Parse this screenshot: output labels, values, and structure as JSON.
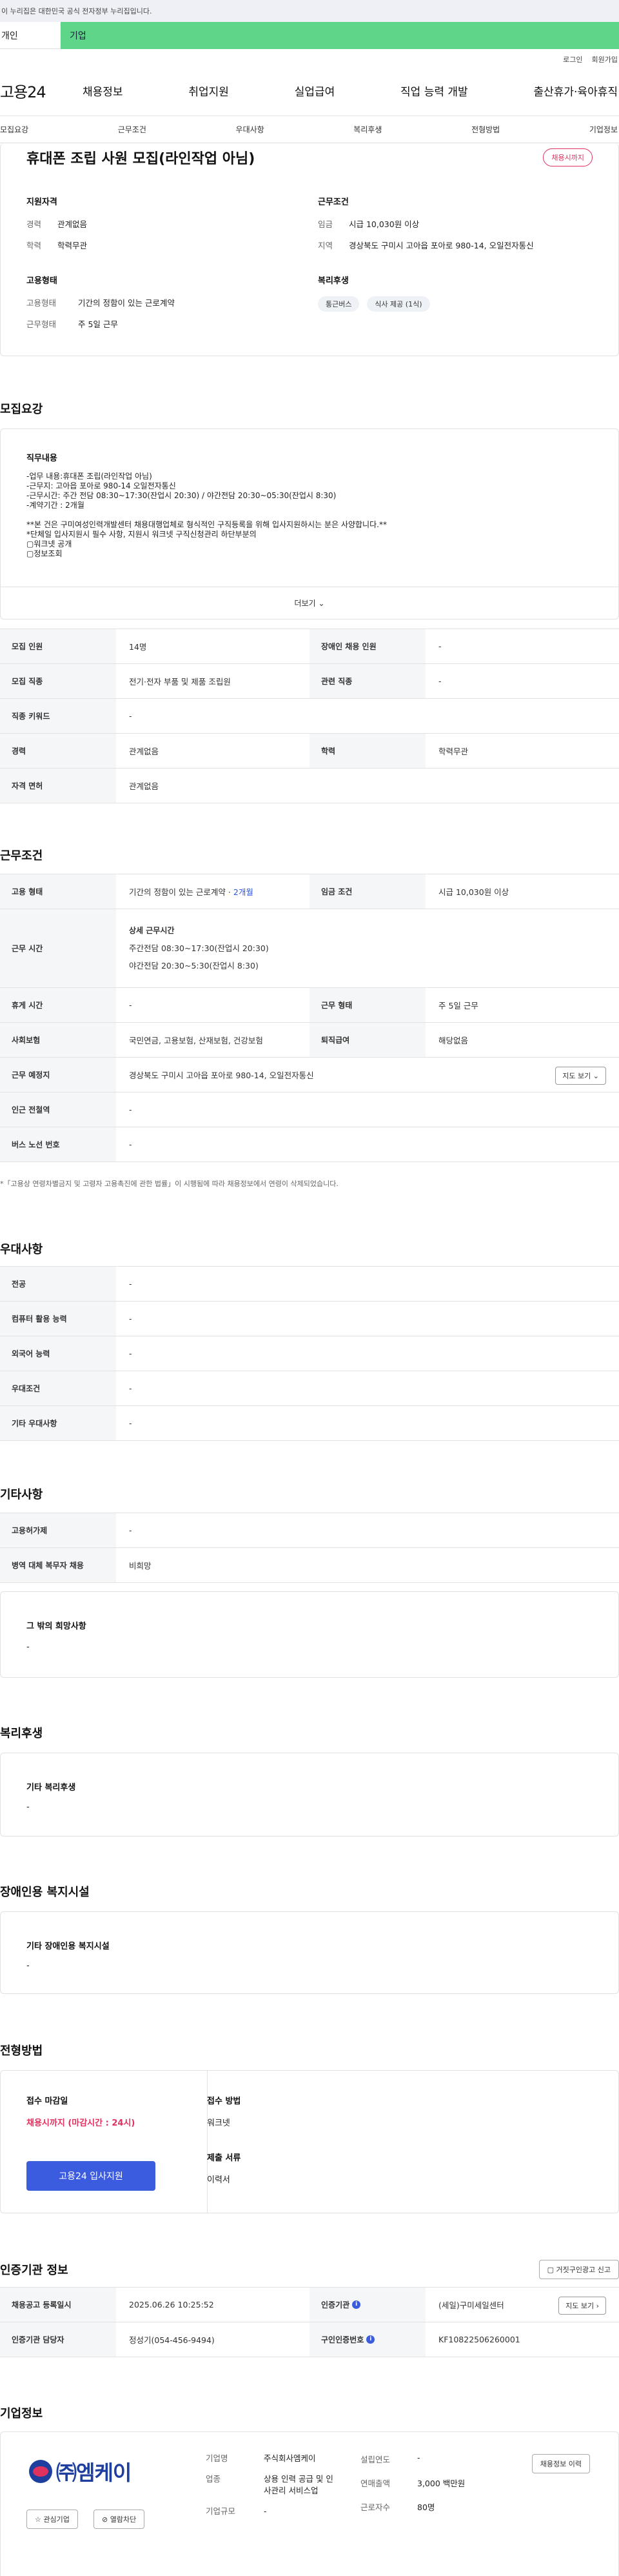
{
  "gov_notice": "이 누리집은 대한민국 공식 전자정부 누리집입니다.",
  "user_tabs": {
    "personal": "개인",
    "corporate": "기업"
  },
  "util": {
    "login": "로그인",
    "join": "회원가입"
  },
  "logo": "고용24",
  "gnb": [
    "채용정보",
    "취업지원",
    "실업급여",
    "직업 능력 개발",
    "출산휴가·육아휴직"
  ],
  "anchor_tabs": [
    "모집요강",
    "근무조건",
    "우대사항",
    "복리후생",
    "전형방법",
    "기업정보"
  ],
  "job": {
    "title": "휴대폰 조립 사원 모집(라인작업 아님)",
    "badge": "채용시까지",
    "qual_title": "지원자격",
    "qual": [
      {
        "k": "경력",
        "v": "관계없음"
      },
      {
        "k": "학력",
        "v": "학력무관"
      }
    ],
    "cond_title": "근무조건",
    "cond": [
      {
        "k": "임금",
        "v": "시급 10,030원 이상"
      },
      {
        "k": "지역",
        "v": "경상북도 구미시 고아읍 포아로 980-14, 오일전자통신"
      }
    ],
    "form_title": "고용형태",
    "form": [
      {
        "k": "고용형태",
        "v": "기간의 정함이 있는 근로계약"
      },
      {
        "k": "근무형태",
        "v": "주 5일 근무"
      }
    ],
    "welfare_title": "복리후생",
    "welfare_chips": [
      "통근버스",
      "식사 제공 (1식)"
    ]
  },
  "recruit": {
    "section_title": "모집요강",
    "duty_title": "직무내용",
    "duty_lines": [
      "-업무 내용:휴대폰 조립(라인작업 아님)",
      "-근무지: 고아읍 포아로 980-14 오일전자통신",
      "-근무시간: 주간 전담 08:30~17:30(잔업시 20:30) / 야간전담 20:30~05:30(잔업시 8:30)",
      "-계약기간 : 2개월",
      "",
      "**본 건은 구미여성인력개발센터 채용대행업체로 형식적인 구직등록을 위해 입사지원하시는 분은 사양합니다.**",
      "*단체일 입사지원시 필수 사항, 지원시 워크넷 구직신청관리 하단부분의",
      "▢워크넷 공개",
      "▢정보조회"
    ],
    "more": "더보기",
    "rows": [
      [
        {
          "k": "모집 인원",
          "v": "14명"
        },
        {
          "k": "장애인 채용 인원",
          "v": "-"
        }
      ],
      [
        {
          "k": "모집 직종",
          "v": "전기·전자 부품 및 제품 조립원"
        },
        {
          "k": "관련 직종",
          "v": "-"
        }
      ],
      [
        {
          "k": "직종 키워드",
          "v": "-"
        }
      ],
      [
        {
          "k": "경력",
          "v": "관계없음"
        },
        {
          "k": "학력",
          "v": "학력무관"
        }
      ],
      [
        {
          "k": "자격 면허",
          "v": "관계없음"
        }
      ]
    ]
  },
  "work": {
    "section_title": "근무조건",
    "emp_k": "고용 형태",
    "emp_v": "기간의 정함이 있는 근로계약 · ",
    "emp_months": "2개월",
    "wage_k": "임금 조건",
    "wage_v": "시급 10,030원 이상",
    "time_k": "근무 시간",
    "time_title": "상세 근무시간",
    "time_lines": [
      "주간전담 08:30~17:30(잔업시 20:30)",
      "야간전담 20:30~5:30(잔업시 8:30)"
    ],
    "rest_k": "휴게 시간",
    "rest_v": "-",
    "shape_k": "근무 형태",
    "shape_v": "주 5일 근무",
    "ins_k": "사회보험",
    "ins_v": "국민연금, 고용보험, 산재보험, 건강보험",
    "sev_k": "퇴직급여",
    "sev_v": "해당없음",
    "loc_k": "근무 예정지",
    "loc_v": "경상북도 구미시 고아읍 포아로 980-14, 오일전자통신",
    "map_btn": "지도 보기",
    "sub_k": "인근 전철역",
    "sub_v": "-",
    "bus_k": "버스 노선 번호",
    "bus_v": "-",
    "note": "*「고용상 연령차별금지 및 고령자 고용촉진에 관한 법률」이 시행됨에 따라 채용정보에서 연령이 삭제되었습니다."
  },
  "pref": {
    "section_title": "우대사항",
    "rows": [
      {
        "k": "전공",
        "v": "-"
      },
      {
        "k": "컴퓨터 활용 능력",
        "v": "-"
      },
      {
        "k": "외국어 능력",
        "v": "-"
      },
      {
        "k": "우대조건",
        "v": "-"
      },
      {
        "k": "기타 우대사항",
        "v": "-"
      }
    ]
  },
  "etc": {
    "section_title": "기타사항",
    "rows": [
      {
        "k": "고용허가제",
        "v": "-"
      },
      {
        "k": "병역 대체 복무자 채용",
        "v": "비희망"
      }
    ],
    "other_title": "그 밖의 희망사항",
    "other_v": "-"
  },
  "welfare": {
    "section_title": "복리후생",
    "box_title": "기타 복리후생",
    "box_v": "-"
  },
  "disab": {
    "section_title": "장애인용 복지시설",
    "box_title": "기타 장애인용 복지시설",
    "box_v": "-"
  },
  "selection": {
    "section_title": "전형방법",
    "deadline_label": "접수 마감일",
    "deadline_v": "채용시까지 (마감시간 : 24시)",
    "method_label": "접수 방법",
    "method_v": "워크넷",
    "docs_label": "제출 서류",
    "docs_v": "이력서",
    "apply_btn": "고용24 입사지원"
  },
  "cert": {
    "section_title": "인증기관 정보",
    "report_btn": "거짓구인광고 신고",
    "reg_k": "채용공고 등록일시",
    "reg_v": "2025.06.26 10:25:52",
    "org_k": "인증기관",
    "org_v": "(세일)구미세일센터",
    "map_btn": "지도 보기",
    "mgr_k": "인증기관 담당자",
    "mgr_v": "정성기(054-456-9494)",
    "num_k": "구인인증번호",
    "num_v": "KF10822506260001"
  },
  "company": {
    "section_title": "기업정보",
    "logo_text": "㈜엠케이",
    "fav_btn": "관심기업",
    "block_btn": "열람차단",
    "name_k": "기업명",
    "name_v": "주식회사엠케이",
    "ind_k": "업종",
    "ind_v": "상용 인력 공급 및 인사관리 서비스업",
    "size_k": "기업규모",
    "size_v": "-",
    "year_k": "설립연도",
    "year_v": "-",
    "sales_k": "연매출액",
    "sales_v": "3,000 백만원",
    "emp_k": "근로자수",
    "emp_v": "80명",
    "info_btn": "채용정보 이력"
  }
}
